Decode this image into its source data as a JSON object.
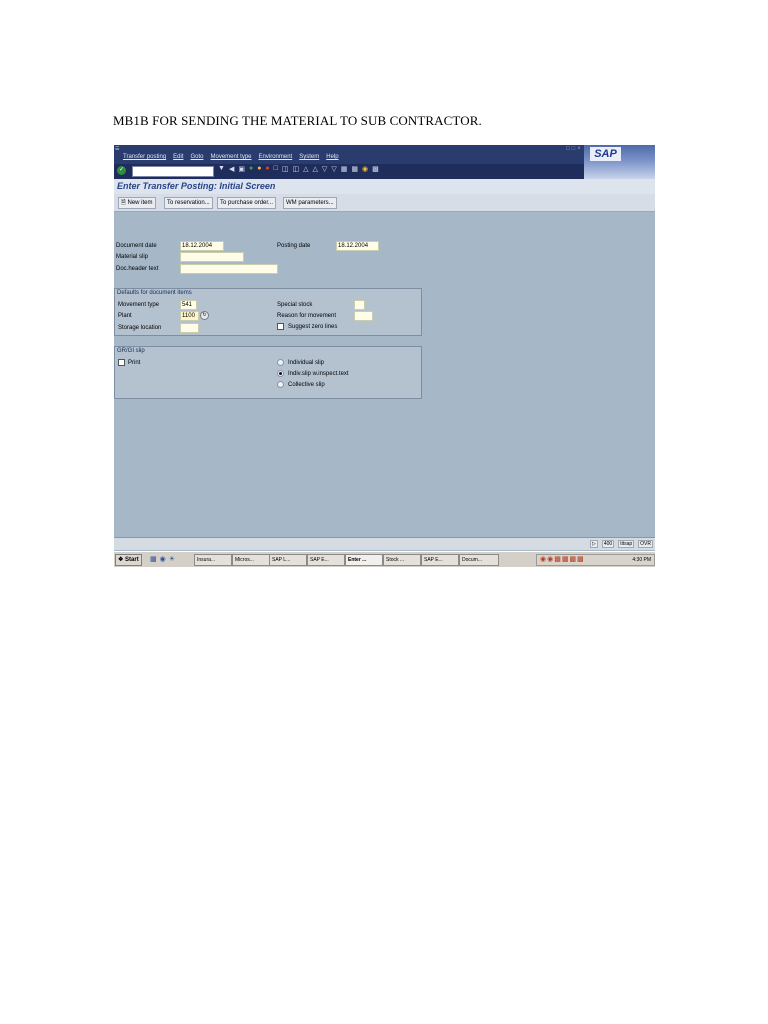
{
  "document": {
    "heading": "MB1B FOR SENDING THE MATERIAL TO SUB CONTRACTOR."
  },
  "sap": {
    "menu": [
      "Transfer posting",
      "Edit",
      "Goto",
      "Movement type",
      "Environment",
      "System",
      "Help"
    ],
    "logo": "SAP",
    "screen_title": "Enter Transfer Posting: Initial Screen",
    "app_buttons": [
      "New item",
      "To reservation...",
      "To purchase order...",
      "WM parameters..."
    ],
    "header_fields": {
      "document_date_label": "Document date",
      "document_date_value": "18.12.2004",
      "posting_date_label": "Posting date",
      "posting_date_value": "18.12.2004",
      "material_slip_label": "Material slip",
      "material_slip_value": "",
      "doc_header_text_label": "Doc.header text",
      "doc_header_text_value": ""
    },
    "defaults_group": {
      "caption": "Defaults for document items",
      "movement_type_label": "Movement type",
      "movement_type_value": "541",
      "plant_label": "Plant",
      "plant_value": "1100",
      "storage_location_label": "Storage location",
      "storage_location_value": "",
      "special_stock_label": "Special stock",
      "special_stock_value": "",
      "reason_for_movement_label": "Reason for movement",
      "reason_for_movement_value": "",
      "suggest_zero_lines_label": "Suggest zero lines",
      "suggest_zero_lines_checked": false
    },
    "grgi_group": {
      "caption": "GR/GI slip",
      "print_label": "Print",
      "print_checked": false,
      "options": [
        {
          "label": "Individual slip",
          "selected": false
        },
        {
          "label": "Indiv.slip w.inspect.text",
          "selected": true
        },
        {
          "label": "Collective slip",
          "selected": false
        }
      ]
    },
    "status": {
      "client": "400",
      "server": "titsap",
      "mode": "OVR"
    },
    "taskbar": {
      "start_label": "Start",
      "tasks": [
        {
          "label": "Insura...",
          "active": false
        },
        {
          "label": "Micros...",
          "active": false
        },
        {
          "label": "SAP L...",
          "active": false
        },
        {
          "label": "SAP E...",
          "active": false
        },
        {
          "label": "Enter ...",
          "active": true
        },
        {
          "label": "Stock ...",
          "active": false
        },
        {
          "label": "SAP E...",
          "active": false
        },
        {
          "label": "Docum...",
          "active": false
        }
      ],
      "clock": "4:30 PM"
    },
    "colors": {
      "menubar": "#2a3b6e",
      "background": "#a6b8c8",
      "title_text": "#27448a"
    }
  }
}
